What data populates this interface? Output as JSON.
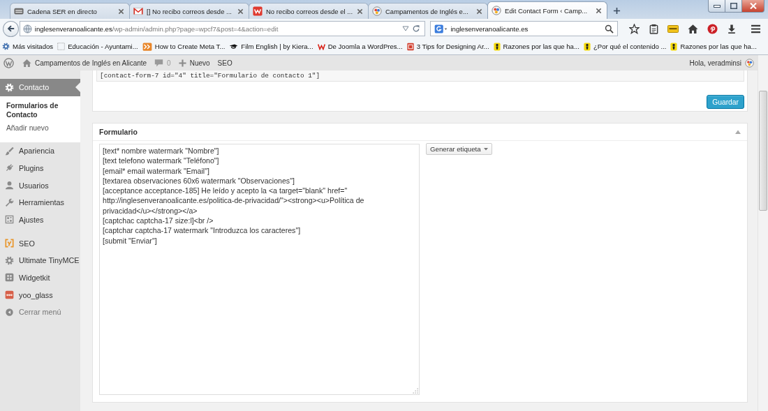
{
  "browser": {
    "tabs": [
      {
        "label": "Cadena SER en directo",
        "selected": false
      },
      {
        "label": "[] No recibo correos desde ...",
        "selected": false
      },
      {
        "label": "No recibo correos desde el ...",
        "selected": false
      },
      {
        "label": "Campamentos de Inglés e...",
        "selected": false
      },
      {
        "label": "Edit Contact Form ‹ Camp...",
        "selected": true
      }
    ],
    "address_bar": {
      "host": "inglesenveranoalicante.es",
      "path": "/wp-admin/admin.php?page=wpcf7&post=4&action=edit"
    },
    "search_field": {
      "value": "inglesenveranoalicante.es"
    },
    "bookmarks": [
      "Más visitados",
      "Educación - Ayuntami...",
      "How to Create Meta T...",
      "Film English | by Kiera...",
      "De Joomla a WordPres...",
      "3 Tips for Designing Ar...",
      "Razones por las que ha...",
      "¿Por qué el contenido ...",
      "Razones por las que ha..."
    ]
  },
  "admin_bar": {
    "site_name": "Campamentos de Inglés en Alicante",
    "comments": "0",
    "new": "Nuevo",
    "seo": "SEO",
    "greeting": "Hola, veradminsi"
  },
  "sidebar": {
    "sections": [
      {
        "items": [
          {
            "label": "Contacto",
            "selected": true,
            "children": [
              {
                "label": "Formularios de Contacto",
                "selected": true
              },
              {
                "label": "Añadir nuevo",
                "selected": false
              }
            ]
          },
          {
            "label": "Apariencia",
            "selected": false
          },
          {
            "label": "Plugins",
            "selected": false
          },
          {
            "label": "Usuarios",
            "selected": false
          },
          {
            "label": "Herramientas",
            "selected": false
          },
          {
            "label": "Ajustes",
            "selected": false
          }
        ]
      },
      {
        "items": [
          {
            "label": "SEO",
            "selected": false
          },
          {
            "label": "Ultimate TinyMCE",
            "selected": false
          },
          {
            "label": "Widgetkit",
            "selected": false
          },
          {
            "label": "yoo_glass",
            "selected": false
          }
        ]
      }
    ],
    "collapse": "Cerrar menú"
  },
  "shortcode_panel": {
    "shortcode": "[contact-form-7 id=\"4\" title=\"Formulario de contacto 1\"]",
    "save_button": "Guardar"
  },
  "form_panel": {
    "title": "Formulario",
    "template_lines": [
      "[text* nombre watermark \"Nombre\"]",
      "[text telefono watermark \"Teléfono\"]",
      "[email* email watermark \"Email\"]",
      "[textarea observaciones 60x6 watermark \"Observaciones\"]",
      "[acceptance acceptance-185] He leído y acepto la <a target=\"blank\" href=\"",
      "http://inglesenveranoalicante.es/politica-de-privacidad/\"><strong><u>Política de",
      "privacidad</u></strong></a>",
      "[captchac captcha-17 size:l]<br />",
      "[captchar captcha-17 watermark \"Introduzca los caracteres\"]",
      "[submit \"Enviar\"]"
    ],
    "tag_button": "Generar etiqueta"
  }
}
